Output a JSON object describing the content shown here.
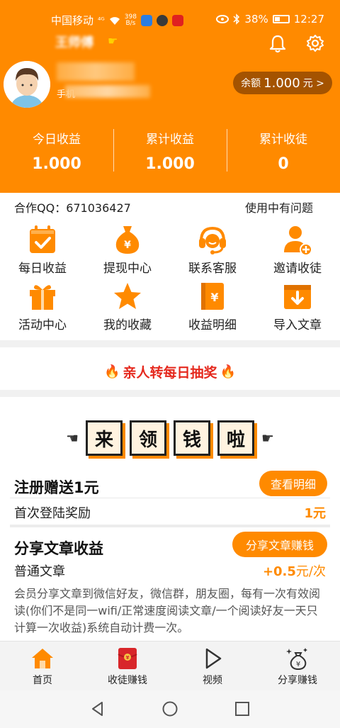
{
  "status_bar": {
    "carrier": "中国移动",
    "signal": "⁴ᴳ",
    "net_speed_top": "398",
    "net_speed_bottom": "B/s",
    "battery": "38%",
    "time": "12:27"
  },
  "header": {
    "app_title": "王师傅",
    "phone_label": "手机",
    "balance_label": "余额",
    "balance_amount": "1.000",
    "balance_unit": "元 >",
    "stats": [
      {
        "label": "今日收益",
        "value": "1.000"
      },
      {
        "label": "累计收益",
        "value": "1.000"
      },
      {
        "label": "累计收徒",
        "value": "0"
      }
    ],
    "icons": {
      "bell": "bell-icon",
      "settings": "gear-icon"
    }
  },
  "info": {
    "qq": "合作QQ：671036427",
    "help": "使用中有问题"
  },
  "grid": [
    [
      {
        "label": "每日收益",
        "icon": "calendar-check-icon"
      },
      {
        "label": "提现中心",
        "icon": "money-bag-icon"
      },
      {
        "label": "联系客服",
        "icon": "headset-icon"
      },
      {
        "label": "邀请收徒",
        "icon": "add-user-icon"
      }
    ],
    [
      {
        "label": "活动中心",
        "icon": "gift-icon"
      },
      {
        "label": "我的收藏",
        "icon": "star-icon"
      },
      {
        "label": "收益明细",
        "icon": "ledger-icon"
      },
      {
        "label": "导入文章",
        "icon": "import-icon"
      }
    ]
  ],
  "lottery": {
    "text": "亲人转每日抽奖",
    "flame": "🔥"
  },
  "banner": {
    "chars": [
      "来",
      "领",
      "钱",
      "啦"
    ],
    "hand_left": "☚",
    "hand_right": "☛"
  },
  "rewards": [
    {
      "title": "注册赠送1元",
      "button": "查看明细",
      "sub": "首次登陆奖励",
      "value": "1元",
      "per": ""
    },
    {
      "title": "分享文章收益",
      "button": "分享文章赚钱",
      "sub": "普通文章",
      "value": "+0.5",
      "per": "元/次"
    }
  ],
  "description": "会员分享文章到微信好友，微信群，朋友圈，每有一次有效阅读(你们不是同一wifi/正常速度阅读文章/一个阅读好友一天只计算一次收益)系统自动计费一次。",
  "bottom_nav": [
    {
      "label": "首页",
      "icon": "home-icon",
      "active": true
    },
    {
      "label": "收徒赚钱",
      "icon": "red-envelope-icon",
      "active": false
    },
    {
      "label": "视频",
      "icon": "play-icon",
      "active": false
    },
    {
      "label": "分享赚钱",
      "icon": "money-bag-sparkle-icon",
      "active": false
    }
  ],
  "colors": {
    "brand": "#ff8a00",
    "pill": "#a45300",
    "lottery": "#e5291e"
  }
}
